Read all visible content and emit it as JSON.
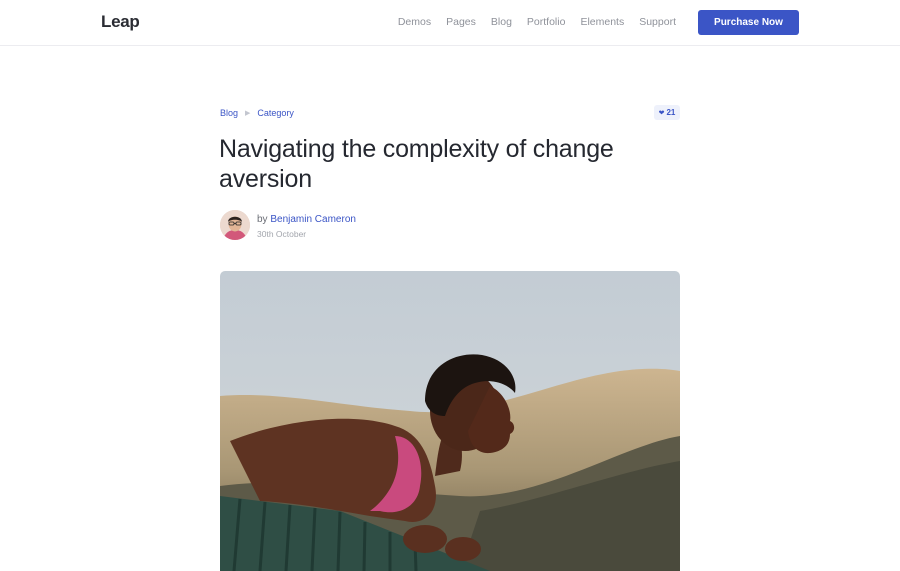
{
  "brand": {
    "logo": "Leap"
  },
  "nav": {
    "items": [
      "Demos",
      "Pages",
      "Blog",
      "Portfolio",
      "Elements",
      "Support"
    ],
    "cta_label": "Purchase Now"
  },
  "breadcrumb": {
    "items": [
      "Blog",
      "Category"
    ],
    "separator_icon": "triangle-right-icon"
  },
  "likes": {
    "icon": "heart-icon",
    "count": "21"
  },
  "article": {
    "title": "Navigating the complexity of change aversion",
    "author_prefix": "by",
    "author_name": "Benjamin Cameron",
    "date": "30th October"
  },
  "colors": {
    "accent": "#3b55c6",
    "text_dark": "#252830",
    "text_muted": "#8f929a",
    "badge_bg": "#eef1fb"
  }
}
